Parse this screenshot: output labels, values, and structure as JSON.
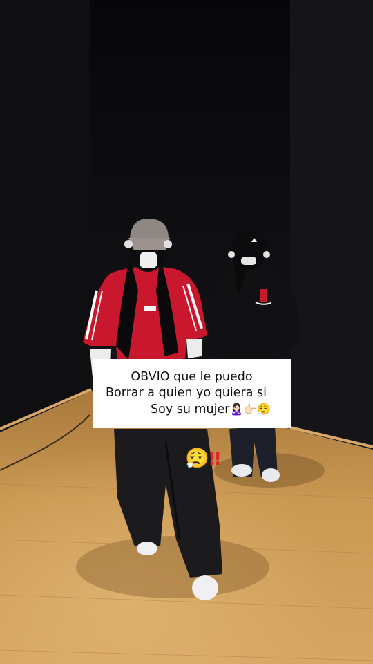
{
  "caption": {
    "line1": "OBVIO que le puedo",
    "line2": "Borrar a quien yo quiera si",
    "line3": "Soy su mujer",
    "line3_emojis": "🙎🏻‍♀️👉🏻😮‍💨"
  },
  "sticker": {
    "emoji": "😮‍💨",
    "mark": "‼"
  },
  "colors": {
    "wall": "#121214",
    "floor": "#c69550",
    "jersey": "#c9182e",
    "pants": "#1c1c1f",
    "caption_bg": "#ffffff",
    "exclaim": "#e0242a"
  }
}
